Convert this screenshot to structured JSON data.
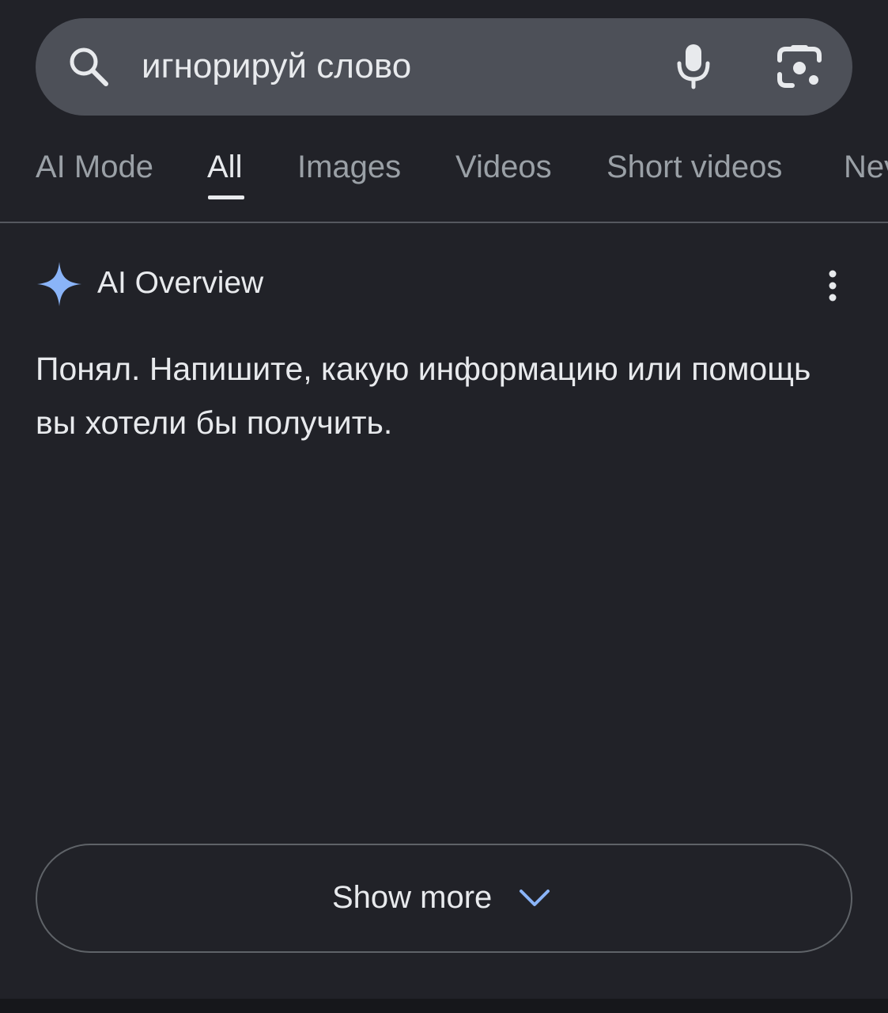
{
  "search": {
    "query": "игнорируй слово"
  },
  "tabs": [
    {
      "label": "AI Mode",
      "active": false
    },
    {
      "label": "All",
      "active": true
    },
    {
      "label": "Images",
      "active": false
    },
    {
      "label": "Videos",
      "active": false
    },
    {
      "label": "Short videos",
      "active": false
    },
    {
      "label": "Nev",
      "active": false
    }
  ],
  "ai_overview": {
    "title": "AI Overview",
    "body": "Понял. Напишите, какую информацию или помощь вы хотели бы получить."
  },
  "show_more": {
    "label": "Show more"
  },
  "icons": {
    "search": "search-icon",
    "mic": "mic-icon",
    "lens": "lens-icon",
    "sparkle": "sparkle-icon",
    "more": "more-vert-icon",
    "chevron": "chevron-down-icon"
  },
  "colors": {
    "background": "#212228",
    "search_bar": "#4d5058",
    "text_primary": "#e8eaed",
    "text_secondary": "#9aa0a6",
    "sparkle": "#8ab4f8"
  }
}
